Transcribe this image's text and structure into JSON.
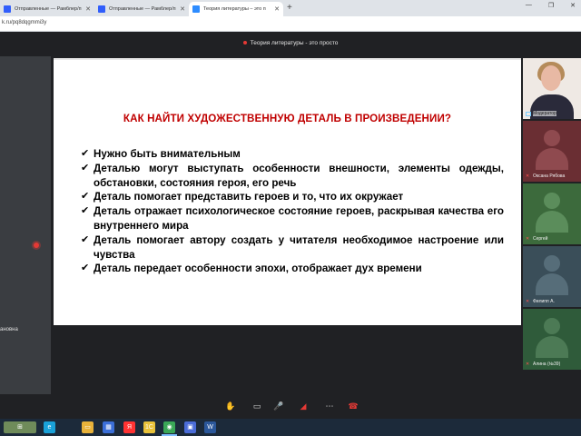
{
  "browser": {
    "tabs": [
      {
        "label": "Отправленные — Рамблер/п",
        "active": false,
        "fav_color": "#315efb"
      },
      {
        "label": "Отправленные — Рамблер/п",
        "active": false,
        "fav_color": "#315efb"
      },
      {
        "label": "Теория литературы – это п",
        "active": true,
        "fav_color": "#2d8cff"
      }
    ],
    "new_tab": "+",
    "window_controls": [
      "—",
      "❐",
      "✕"
    ],
    "url": "k.ru/pq8dqgmmi3y"
  },
  "meeting": {
    "title": "Теория литературы - это просто",
    "left_participant_name": "ановна",
    "participants": [
      {
        "name": "Модератор",
        "camera": true,
        "icon": "screen-icon"
      },
      {
        "name": "Оксана Рябова",
        "camera": false,
        "bg": "#6a2e33",
        "head": "#8f4a4f",
        "icon": "mic-muted-icon"
      },
      {
        "name": "Сергей",
        "camera": false,
        "bg": "#3c6a3c",
        "head": "#5b8d5b",
        "icon": "mic-muted-icon"
      },
      {
        "name": "Филипп А.",
        "camera": false,
        "bg": "#3a4e59",
        "head": "#566d79",
        "icon": "mic-muted-icon"
      },
      {
        "name": "Алина (№39)",
        "camera": false,
        "bg": "#2f5b3a",
        "head": "#4c7a55",
        "icon": "mic-muted-icon"
      }
    ]
  },
  "slide": {
    "title": "КАК НАЙТИ ХУДОЖЕСТВЕННУЮ ДЕТАЛЬ В ПРОИЗВЕДЕНИИ?",
    "check_glyph": "✔",
    "bullets": [
      "Нужно быть внимательным",
      "Деталью могут выступать особенности внешности, элементы одежды, обстановки, состояния героя, его речь",
      "Деталь помогает представить героев и то, что их окружает",
      "Деталь отражает психологическое состояние героев, раскрывая качества его внутреннего мира",
      "Деталь помогает автору создать у читателя необходимое настроение или чувства",
      "Деталь передает особенности эпохи, отображает дух времени"
    ]
  },
  "controls": [
    {
      "name": "raise-hand-button",
      "icon": "hand-icon",
      "glyph": "✋",
      "red": false
    },
    {
      "name": "screen-share-button",
      "icon": "screen-share-icon",
      "glyph": "▭",
      "red": false
    },
    {
      "name": "microphone-button",
      "icon": "mic-muted-icon",
      "glyph": "🎤",
      "red": true
    },
    {
      "name": "camera-button",
      "icon": "camera-off-icon",
      "glyph": "◢",
      "red": true
    },
    {
      "name": "more-button",
      "icon": "more-icon",
      "glyph": "⋯",
      "red": false
    },
    {
      "name": "leave-button",
      "icon": "phone-hangup-icon",
      "glyph": "☎",
      "red": true
    }
  ],
  "taskbar": {
    "icons": [
      {
        "name": "start-icon",
        "color": "#3b78d8",
        "glyph": "⊞"
      },
      {
        "name": "edge-icon",
        "color": "#1aa1d8",
        "glyph": "e"
      },
      {
        "name": "explorer-icon",
        "color": "#e8b23a",
        "glyph": "▭"
      },
      {
        "name": "store-icon",
        "color": "#3b6fd8",
        "glyph": "▦"
      },
      {
        "name": "yandex-icon",
        "color": "#ff3333",
        "glyph": "Я"
      },
      {
        "name": "onec-icon",
        "color": "#e8c23a",
        "glyph": "1С"
      },
      {
        "name": "chrome-icon",
        "color": "#3aa757",
        "glyph": "◉"
      },
      {
        "name": "webinar-icon",
        "color": "#4a6cd8",
        "glyph": "▣"
      },
      {
        "name": "word-icon",
        "color": "#2b579a",
        "glyph": "W"
      }
    ]
  }
}
